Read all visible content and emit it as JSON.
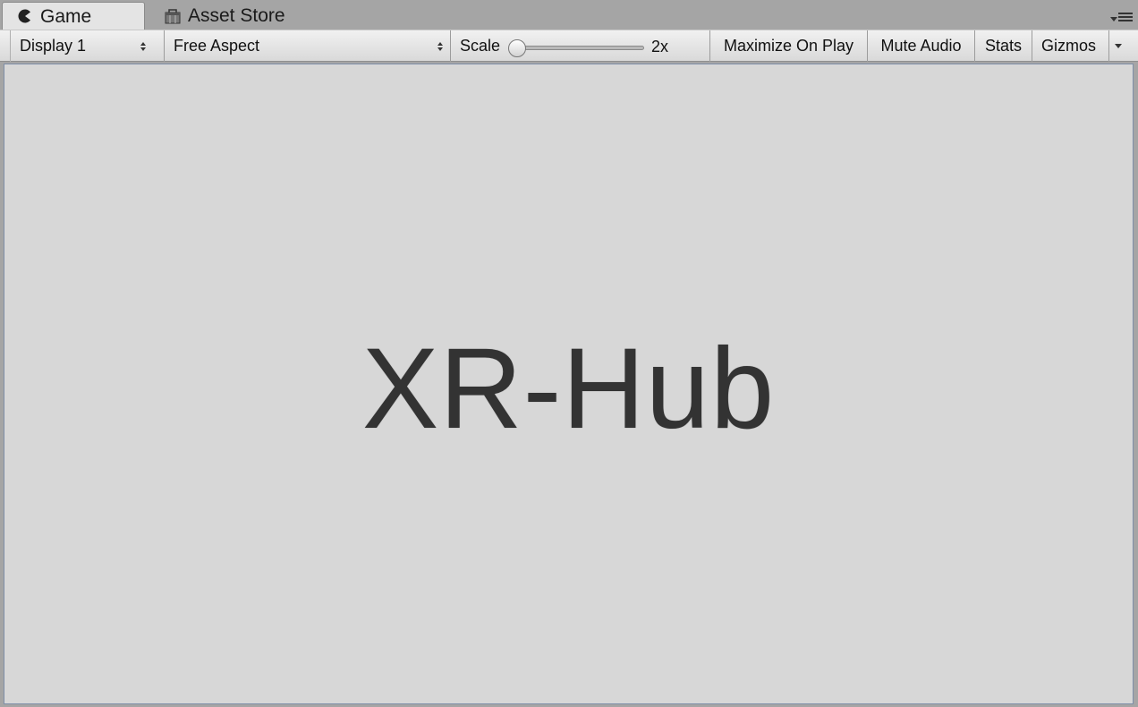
{
  "tabs": [
    {
      "label": "Game",
      "icon": "pacman-icon",
      "active": true
    },
    {
      "label": "Asset Store",
      "icon": "shopping-bag-icon",
      "active": false
    }
  ],
  "toolbar": {
    "display": {
      "selected": "Display 1"
    },
    "aspect": {
      "selected": "Free Aspect"
    },
    "scale": {
      "label": "Scale",
      "value": "2x"
    },
    "maximize_label": "Maximize On Play",
    "mute_label": "Mute Audio",
    "stats_label": "Stats",
    "gizmos_label": "Gizmos"
  },
  "game": {
    "title": "XR-Hub"
  },
  "colors": {
    "game_background": "#d7d7d7",
    "title_text": "#333333",
    "active_tab": "#e4e4e4"
  }
}
